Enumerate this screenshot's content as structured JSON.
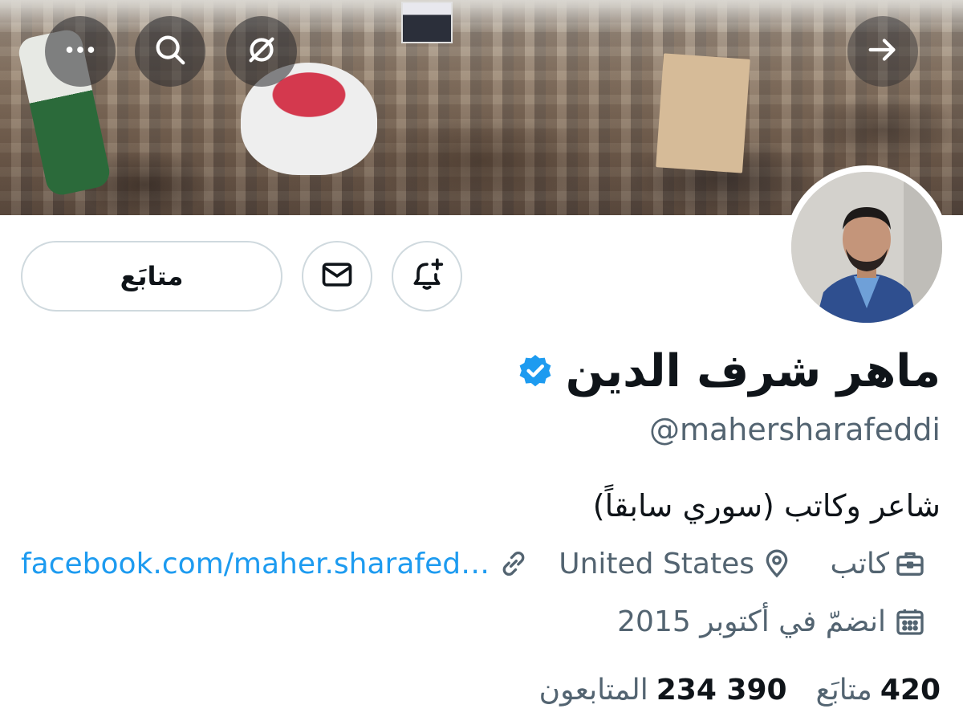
{
  "colors": {
    "accent": "#1d9bf0",
    "text_primary": "#0f1419",
    "text_secondary": "#536471",
    "border": "#cfd9de",
    "verified": "#1d9bf0"
  },
  "top_bar": {
    "icons": [
      "more-icon",
      "search-icon",
      "grok-icon",
      "arrow-right-icon"
    ]
  },
  "actions": {
    "following_label": "متابَع",
    "message_icon": "mail-icon",
    "notify_icon": "bell-plus-icon"
  },
  "profile": {
    "name": "ماهر شرف الدين",
    "handle": "@mahersharafeddi",
    "bio": "شاعر وكاتب (سوري سابقاً)",
    "profession": "كاتب",
    "location": "United States",
    "website": "facebook.com/maher.sharafed…",
    "joined": "انضمّ في أكتوبر 2015"
  },
  "stats": {
    "following_count": "420",
    "following_label": "متابَع",
    "followers_count": "234 390",
    "followers_label": "المتابعون"
  }
}
